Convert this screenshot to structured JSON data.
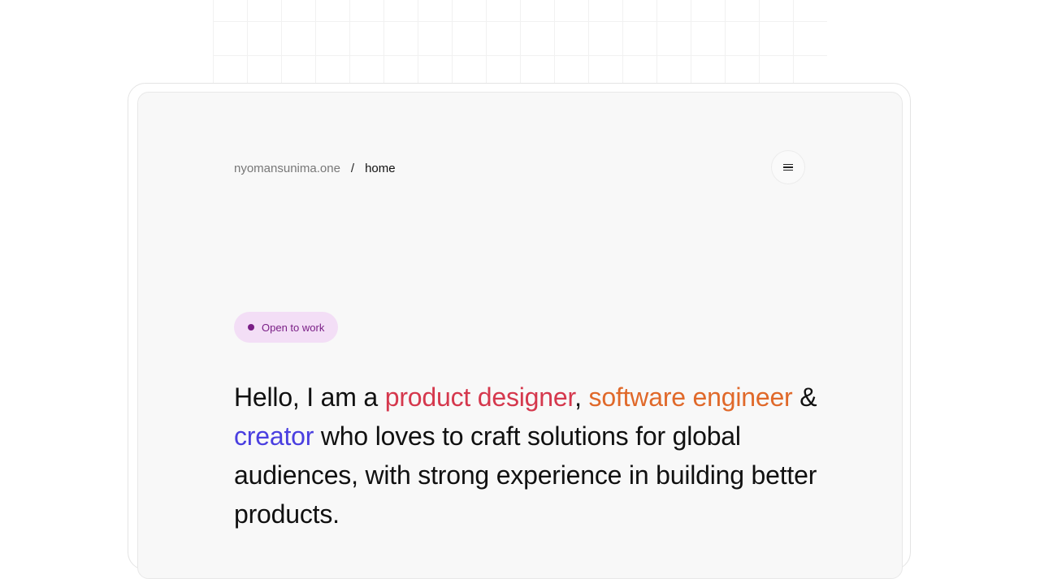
{
  "breadcrumb": {
    "site": "nyomansunima.one",
    "separator": "/",
    "current": "home"
  },
  "menu": {
    "icon": "hamburger-menu-icon"
  },
  "status": {
    "label": "Open to work",
    "color": "#7a1f86",
    "background": "#f3def6"
  },
  "hero": {
    "prefix": "Hello, I am a ",
    "role1": "product designer",
    "sep1": ", ",
    "role2": "software engineer",
    "sep2": " & ",
    "role3": "creator",
    "suffix": " who loves to craft solutions for global audiences, with strong experience in building better products.",
    "colors": {
      "role1": "#d5384d",
      "role2": "#e0692a",
      "role3": "#4a3fe0"
    }
  }
}
